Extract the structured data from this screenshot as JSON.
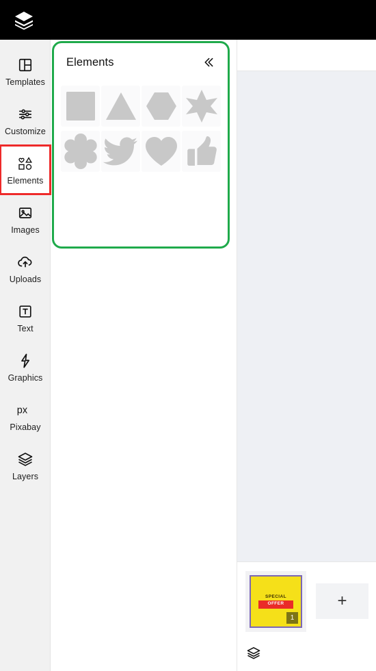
{
  "header": {
    "logo_icon": "layers-stack-icon",
    "background": "#000000"
  },
  "sidebar": {
    "background": "#f1f1f1",
    "active_index": 2,
    "active_highlight_color": "#ee2a2a",
    "items": [
      {
        "label": "Templates",
        "icon": "templates-grid-icon"
      },
      {
        "label": "Customize",
        "icon": "sliders-icon"
      },
      {
        "label": "Elements",
        "icon": "shapes-grid-icon"
      },
      {
        "label": "Images",
        "icon": "image-picture-icon"
      },
      {
        "label": "Uploads",
        "icon": "cloud-upload-icon"
      },
      {
        "label": "Text",
        "icon": "text-box-icon"
      },
      {
        "label": "Graphics",
        "icon": "lightning-bolt-icon"
      },
      {
        "label": "Pixabay",
        "icon": "pixabay-px-icon"
      },
      {
        "label": "Layers",
        "icon": "layers-stack-icon"
      }
    ]
  },
  "panel": {
    "title": "Elements",
    "border_color": "#1faa4b",
    "collapse_icon": "double-chevron-left-icon",
    "shapes": [
      {
        "name": "square",
        "icon": "square-shape-icon"
      },
      {
        "name": "triangle",
        "icon": "triangle-shape-icon"
      },
      {
        "name": "hexagon",
        "icon": "hexagon-shape-icon"
      },
      {
        "name": "star",
        "icon": "six-point-star-shape-icon"
      },
      {
        "name": "flower",
        "icon": "flower-shape-icon"
      },
      {
        "name": "bird",
        "icon": "bird-shape-icon"
      },
      {
        "name": "heart",
        "icon": "heart-shape-icon"
      },
      {
        "name": "thumbs-up",
        "icon": "thumbs-up-shape-icon"
      }
    ],
    "shape_fill": "#c8c8c8"
  },
  "workspace": {
    "canvas_background": "#eef0f4",
    "pages": {
      "thumbnail": {
        "background": "#f5e019",
        "selection_color": "#7b67b4",
        "line1": "SPECIAL",
        "line2": "OFFER",
        "banner_color": "#ea2b28",
        "badge": "1",
        "badge_color": "#7d7416"
      },
      "add_label": "+",
      "layers_icon": "layers-stack-icon"
    }
  }
}
